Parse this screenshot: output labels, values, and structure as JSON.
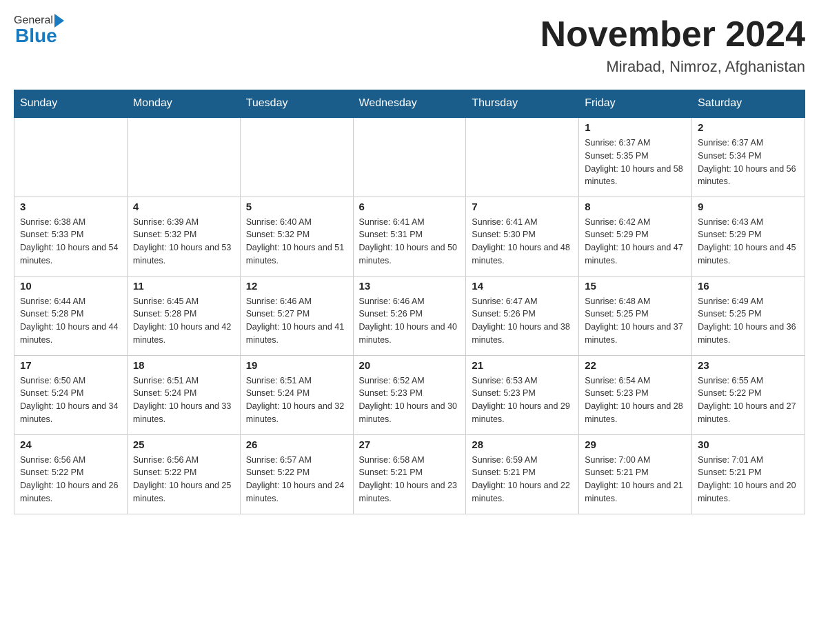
{
  "header": {
    "logo_general": "General",
    "logo_blue": "Blue",
    "title": "November 2024",
    "subtitle": "Mirabad, Nimroz, Afghanistan"
  },
  "days_of_week": [
    "Sunday",
    "Monday",
    "Tuesday",
    "Wednesday",
    "Thursday",
    "Friday",
    "Saturday"
  ],
  "weeks": [
    [
      {
        "day": "",
        "info": ""
      },
      {
        "day": "",
        "info": ""
      },
      {
        "day": "",
        "info": ""
      },
      {
        "day": "",
        "info": ""
      },
      {
        "day": "",
        "info": ""
      },
      {
        "day": "1",
        "info": "Sunrise: 6:37 AM\nSunset: 5:35 PM\nDaylight: 10 hours and 58 minutes."
      },
      {
        "day": "2",
        "info": "Sunrise: 6:37 AM\nSunset: 5:34 PM\nDaylight: 10 hours and 56 minutes."
      }
    ],
    [
      {
        "day": "3",
        "info": "Sunrise: 6:38 AM\nSunset: 5:33 PM\nDaylight: 10 hours and 54 minutes."
      },
      {
        "day": "4",
        "info": "Sunrise: 6:39 AM\nSunset: 5:32 PM\nDaylight: 10 hours and 53 minutes."
      },
      {
        "day": "5",
        "info": "Sunrise: 6:40 AM\nSunset: 5:32 PM\nDaylight: 10 hours and 51 minutes."
      },
      {
        "day": "6",
        "info": "Sunrise: 6:41 AM\nSunset: 5:31 PM\nDaylight: 10 hours and 50 minutes."
      },
      {
        "day": "7",
        "info": "Sunrise: 6:41 AM\nSunset: 5:30 PM\nDaylight: 10 hours and 48 minutes."
      },
      {
        "day": "8",
        "info": "Sunrise: 6:42 AM\nSunset: 5:29 PM\nDaylight: 10 hours and 47 minutes."
      },
      {
        "day": "9",
        "info": "Sunrise: 6:43 AM\nSunset: 5:29 PM\nDaylight: 10 hours and 45 minutes."
      }
    ],
    [
      {
        "day": "10",
        "info": "Sunrise: 6:44 AM\nSunset: 5:28 PM\nDaylight: 10 hours and 44 minutes."
      },
      {
        "day": "11",
        "info": "Sunrise: 6:45 AM\nSunset: 5:28 PM\nDaylight: 10 hours and 42 minutes."
      },
      {
        "day": "12",
        "info": "Sunrise: 6:46 AM\nSunset: 5:27 PM\nDaylight: 10 hours and 41 minutes."
      },
      {
        "day": "13",
        "info": "Sunrise: 6:46 AM\nSunset: 5:26 PM\nDaylight: 10 hours and 40 minutes."
      },
      {
        "day": "14",
        "info": "Sunrise: 6:47 AM\nSunset: 5:26 PM\nDaylight: 10 hours and 38 minutes."
      },
      {
        "day": "15",
        "info": "Sunrise: 6:48 AM\nSunset: 5:25 PM\nDaylight: 10 hours and 37 minutes."
      },
      {
        "day": "16",
        "info": "Sunrise: 6:49 AM\nSunset: 5:25 PM\nDaylight: 10 hours and 36 minutes."
      }
    ],
    [
      {
        "day": "17",
        "info": "Sunrise: 6:50 AM\nSunset: 5:24 PM\nDaylight: 10 hours and 34 minutes."
      },
      {
        "day": "18",
        "info": "Sunrise: 6:51 AM\nSunset: 5:24 PM\nDaylight: 10 hours and 33 minutes."
      },
      {
        "day": "19",
        "info": "Sunrise: 6:51 AM\nSunset: 5:24 PM\nDaylight: 10 hours and 32 minutes."
      },
      {
        "day": "20",
        "info": "Sunrise: 6:52 AM\nSunset: 5:23 PM\nDaylight: 10 hours and 30 minutes."
      },
      {
        "day": "21",
        "info": "Sunrise: 6:53 AM\nSunset: 5:23 PM\nDaylight: 10 hours and 29 minutes."
      },
      {
        "day": "22",
        "info": "Sunrise: 6:54 AM\nSunset: 5:23 PM\nDaylight: 10 hours and 28 minutes."
      },
      {
        "day": "23",
        "info": "Sunrise: 6:55 AM\nSunset: 5:22 PM\nDaylight: 10 hours and 27 minutes."
      }
    ],
    [
      {
        "day": "24",
        "info": "Sunrise: 6:56 AM\nSunset: 5:22 PM\nDaylight: 10 hours and 26 minutes."
      },
      {
        "day": "25",
        "info": "Sunrise: 6:56 AM\nSunset: 5:22 PM\nDaylight: 10 hours and 25 minutes."
      },
      {
        "day": "26",
        "info": "Sunrise: 6:57 AM\nSunset: 5:22 PM\nDaylight: 10 hours and 24 minutes."
      },
      {
        "day": "27",
        "info": "Sunrise: 6:58 AM\nSunset: 5:21 PM\nDaylight: 10 hours and 23 minutes."
      },
      {
        "day": "28",
        "info": "Sunrise: 6:59 AM\nSunset: 5:21 PM\nDaylight: 10 hours and 22 minutes."
      },
      {
        "day": "29",
        "info": "Sunrise: 7:00 AM\nSunset: 5:21 PM\nDaylight: 10 hours and 21 minutes."
      },
      {
        "day": "30",
        "info": "Sunrise: 7:01 AM\nSunset: 5:21 PM\nDaylight: 10 hours and 20 minutes."
      }
    ]
  ]
}
